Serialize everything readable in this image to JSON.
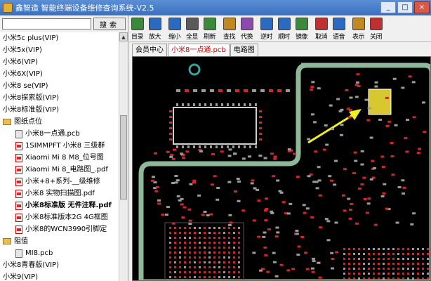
{
  "window": {
    "title": "鑫智造 智能终端设备维修查询系统-V2.5",
    "controls": [
      "_",
      "□",
      "×"
    ]
  },
  "search": {
    "value": "",
    "button_label": "搜索"
  },
  "tree": [
    {
      "label": "小米5c plus(VIP)",
      "kind": "item"
    },
    {
      "label": "小米5x(VIP)",
      "kind": "item"
    },
    {
      "label": "小米6(VIP)",
      "kind": "item"
    },
    {
      "label": "小米6X(VIP)",
      "kind": "item"
    },
    {
      "label": "小米8 se(VIP)",
      "kind": "item"
    },
    {
      "label": "小米8探索版(VIP)",
      "kind": "item"
    },
    {
      "label": "小米8标准版(VIP)",
      "kind": "item"
    },
    {
      "label": "图纸点位",
      "kind": "folder"
    },
    {
      "label": "小米8一点通.pcb",
      "kind": "pcb"
    },
    {
      "label": "1SIMMPFT 小米8 三级群",
      "kind": "pdf"
    },
    {
      "label": "Xiaomi Mi 8 M8_位号图",
      "kind": "pdf"
    },
    {
      "label": "Xiaomi Mi 8_电路图_.pdf",
      "kind": "pdf"
    },
    {
      "label": "小米+8+系列-__级维修",
      "kind": "pdf"
    },
    {
      "label": "小米8 实物扫描图.pdf",
      "kind": "pdf"
    },
    {
      "label": "小米8标准版 无件注释.pdf",
      "kind": "pdf",
      "bold": true
    },
    {
      "label": "小米8标准版本2G 4G框图",
      "kind": "pdf"
    },
    {
      "label": "小米8的WCN3990引脚定",
      "kind": "pdf"
    },
    {
      "label": "阻值",
      "kind": "folder"
    },
    {
      "label": "MI8.pcb",
      "kind": "pcb"
    },
    {
      "label": "小米8青春版(VIP)",
      "kind": "item"
    },
    {
      "label": "小米9(VIP)",
      "kind": "item"
    }
  ],
  "toolbar": [
    {
      "label": "目录",
      "icon": "catalog-icon",
      "color": "#3a8a3a"
    },
    {
      "label": "放大",
      "icon": "zoom-in-icon",
      "color": "#2a6ac0"
    },
    {
      "label": "缩小",
      "icon": "zoom-out-icon",
      "color": "#2a6ac0"
    },
    {
      "label": "全显",
      "icon": "fit-icon",
      "color": "#5a5a5a"
    },
    {
      "label": "刷新",
      "icon": "refresh-icon",
      "color": "#3a8a3a"
    },
    {
      "label": "查找",
      "icon": "find-icon",
      "color": "#c08a20"
    },
    {
      "label": "代换",
      "icon": "replace-icon",
      "color": "#8a4ab0"
    },
    {
      "label": "逆时",
      "icon": "rotate-ccw-icon",
      "color": "#2a6ac0"
    },
    {
      "label": "顺时",
      "icon": "rotate-cw-icon",
      "color": "#2a6ac0"
    },
    {
      "label": "镜像",
      "icon": "mirror-icon",
      "color": "#3a8a3a"
    },
    {
      "label": "取消",
      "icon": "cancel-icon",
      "color": "#c03030"
    },
    {
      "label": "语音",
      "icon": "voice-icon",
      "color": "#2a6ac0"
    },
    {
      "label": "表示",
      "icon": "display-icon",
      "color": "#c08a20"
    },
    {
      "label": "关闭",
      "icon": "close-icon",
      "color": "#c03030"
    }
  ],
  "tabs": [
    {
      "label": "会员中心",
      "active": false
    },
    {
      "label": "小米8一点通.pcb",
      "active": true
    },
    {
      "label": "电路图",
      "active": false
    }
  ],
  "colors": {
    "board_outline": "#8fb89a",
    "pad_red": "#d02828",
    "pad_gray": "#9a9a9a",
    "highlight": "#d8c830",
    "arrow": "#f0f020"
  }
}
